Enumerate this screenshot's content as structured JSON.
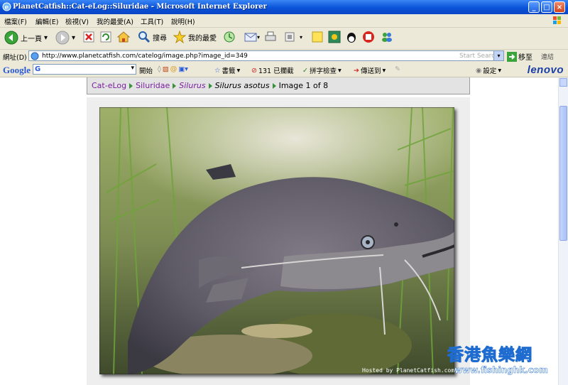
{
  "window": {
    "title": "PlanetCatfish::Cat-eLog::Siluridae - Microsoft Internet Explorer",
    "controls": [
      "_",
      "□",
      "×"
    ]
  },
  "menu": [
    "檔案(F)",
    "編輯(E)",
    "檢視(V)",
    "我的最愛(A)",
    "工具(T)",
    "說明(H)"
  ],
  "toolbar": {
    "back_label": "上一頁",
    "search_label": "搜尋",
    "favorites_label": "我的最愛"
  },
  "address": {
    "label": "網址(D)",
    "url": "http://www.planetcatfish.com/catelog/image.php?image_id=349",
    "search_placeholder": "Start Search",
    "go_label": "移至",
    "links_label": "連結"
  },
  "google_bar": {
    "logo": "Google",
    "input_value": "G",
    "start_label": "開始",
    "bookmarks_label": "書籤",
    "blocked_label": "131 已攔截",
    "spellcheck_label": "拼字檢查",
    "sendto_label": "傳送到",
    "settings_label": "設定",
    "brand": "lenovo"
  },
  "breadcrumb": {
    "items": [
      "Cat-eLog",
      "Siluridae",
      "Silurus",
      "Silurus asotus"
    ],
    "current": "Image 1 of 8"
  },
  "photo": {
    "credit": "Hosted by PlanetCatfish.com"
  },
  "watermark": {
    "chinese": "香港魚樂網",
    "url": "www.fishinghk.com"
  },
  "colors": {
    "titlebar": "#0a53d8",
    "chrome": "#ece9d8",
    "link": "#7a1ea0",
    "separator": "#3b8e3b"
  }
}
